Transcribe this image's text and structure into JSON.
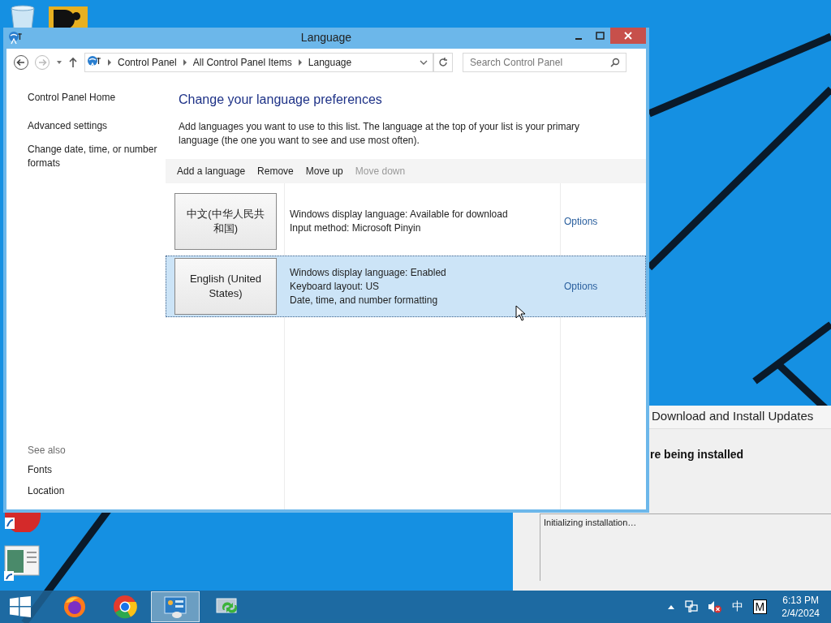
{
  "window": {
    "title": "Language"
  },
  "address_bar": {
    "breadcrumbs": [
      "Control Panel",
      "All Control Panel Items",
      "Language"
    ]
  },
  "search": {
    "placeholder": "Search Control Panel"
  },
  "sidebar": {
    "links": [
      "Control Panel Home",
      "Advanced settings",
      "Change date, time, or number formats"
    ],
    "see_also_heading": "See also",
    "see_also_links": [
      "Fonts",
      "Location"
    ]
  },
  "main": {
    "heading": "Change your language preferences",
    "description": "Add languages you want to use to this list. The language at the top of your list is your primary language (the one you want to see and use most often).",
    "toolbar": [
      {
        "label": "Add a language",
        "disabled": false
      },
      {
        "label": "Remove",
        "disabled": false
      },
      {
        "label": "Move up",
        "disabled": false
      },
      {
        "label": "Move down",
        "disabled": true
      }
    ],
    "languages": [
      {
        "name": "中文(中华人民共和国)",
        "details": [
          "Windows display language: Available for download",
          "Input method: Microsoft Pinyin"
        ],
        "options": "Options",
        "selected": false
      },
      {
        "name": "English (United States)",
        "details": [
          "Windows display language: Enabled",
          "Keyboard layout: US",
          "Date, time, and number formatting"
        ],
        "options": "Options",
        "selected": true
      }
    ]
  },
  "background_window": {
    "title": "Download and Install Updates",
    "heading": "re being installed",
    "log": "Initializing installation…"
  },
  "taskbar": {
    "apps": [
      {
        "kind": "firefox",
        "selected": false
      },
      {
        "kind": "chrome",
        "selected": false
      },
      {
        "kind": "control-panel",
        "selected": true
      },
      {
        "kind": "updater",
        "selected": false
      }
    ],
    "tray": {
      "ime": "中",
      "input_mode": "M"
    },
    "time": "6:13 PM",
    "date": "2/4/2024"
  }
}
